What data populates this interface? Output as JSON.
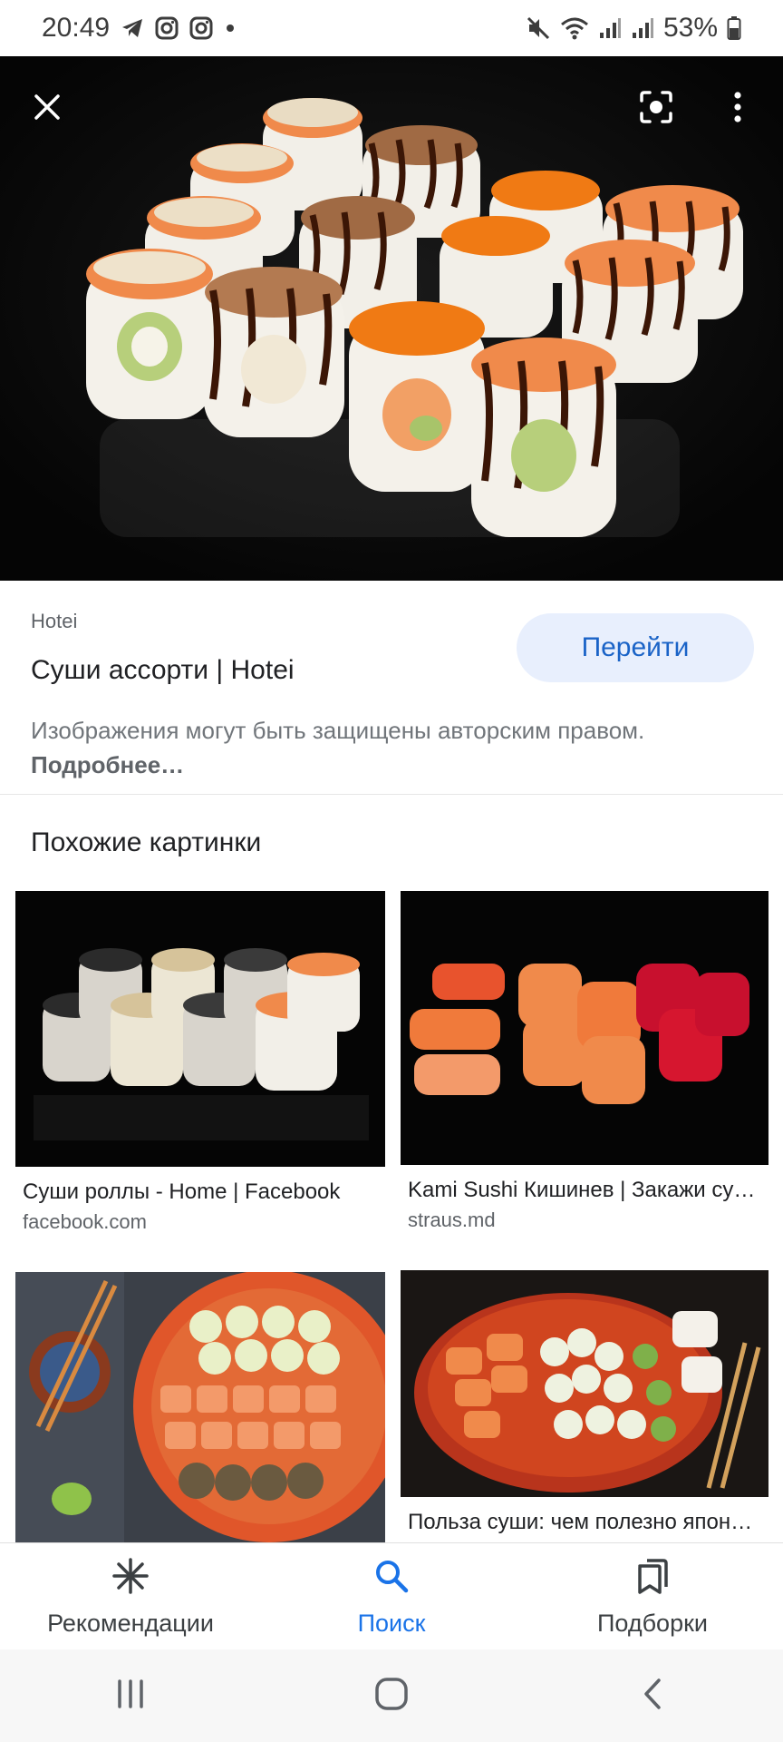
{
  "status_bar": {
    "time": "20:49",
    "left_icons": [
      "telegram-icon",
      "instagram-icon",
      "instagram-icon",
      "dot-icon"
    ],
    "right_icons": [
      "mute-icon",
      "wifi-icon",
      "signal-icon",
      "signal-icon"
    ],
    "battery": "53%"
  },
  "hero": {
    "close_icon": "close-icon",
    "lens_icon": "lens-icon",
    "more_icon": "more-vertical-icon"
  },
  "result": {
    "source": "Hotei",
    "title": "Суши ассорти | Hotei",
    "visit_label": "Перейти",
    "copyright_text": "Изображения могут быть защищены авторским правом.",
    "more_link": "Подробнее…"
  },
  "similar": {
    "heading": "Похожие картинки",
    "items": [
      {
        "title": "Суши роллы - Home | Facebook",
        "domain": "facebook.com"
      },
      {
        "title": "Kami Sushi Кишинев | Закажи суши...",
        "domain": "straus.md"
      },
      {
        "title": "",
        "domain": ""
      },
      {
        "title": "Польза суши: чем полезно японское...",
        "domain": ""
      }
    ]
  },
  "bottom_nav": {
    "items": [
      {
        "label": "Рекомендации",
        "icon": "asterisk-icon"
      },
      {
        "label": "Поиск",
        "icon": "search-icon",
        "active": true
      },
      {
        "label": "Подборки",
        "icon": "collections-icon"
      }
    ]
  },
  "colors": {
    "accent": "#1a73e8",
    "visit_button_bg": "#e8effd",
    "hero_bg": "#080808"
  }
}
